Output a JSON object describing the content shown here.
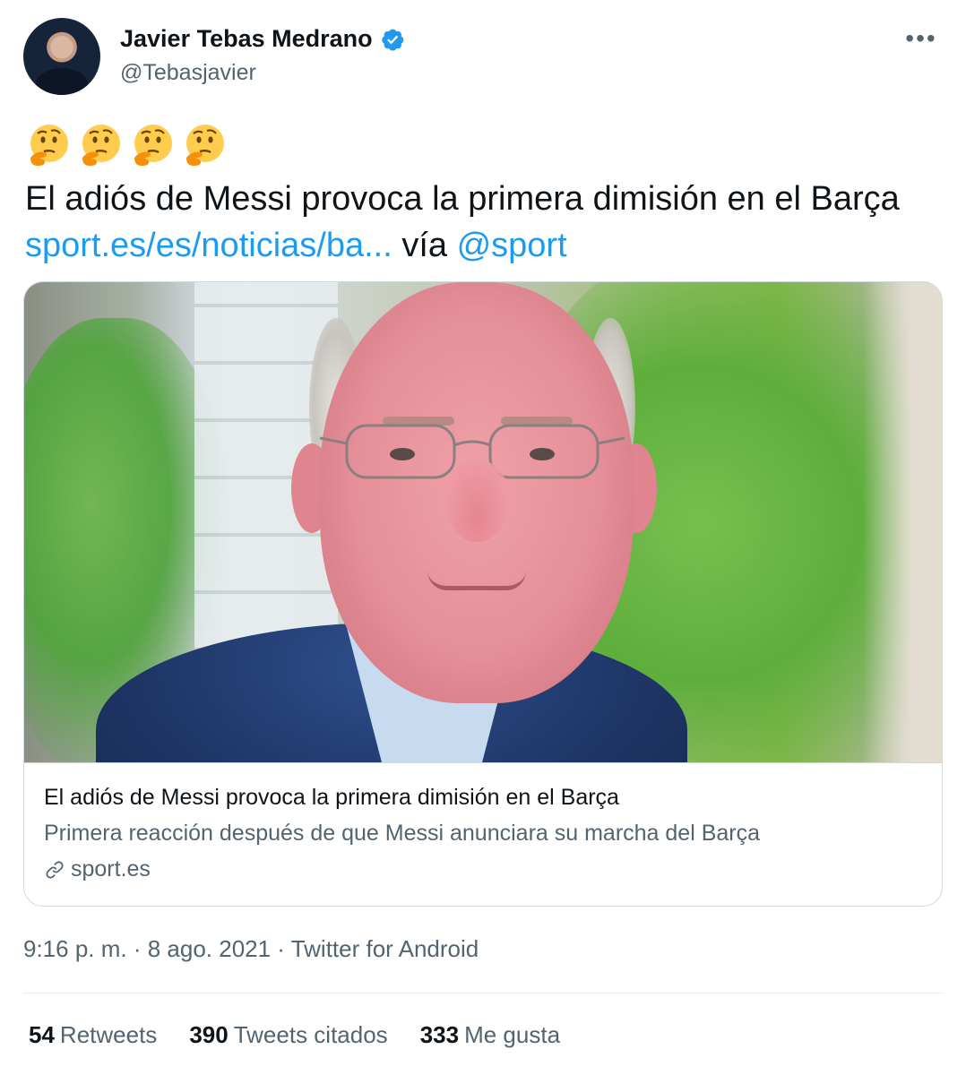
{
  "author": {
    "display_name": "Javier Tebas Medrano",
    "handle": "@Tebasjavier",
    "verified": true
  },
  "more_label": "•••",
  "emojis": [
    "thinking-face",
    "thinking-face",
    "thinking-face",
    "thinking-face"
  ],
  "tweet": {
    "text_main": "El adiós de Messi provoca la primera dimisión en el Barça ",
    "link_url": "sport.es/es/noticias/ba...",
    "via_text": " vía ",
    "mention": "@sport"
  },
  "card": {
    "title": "El adiós de Messi provoca la primera dimisión en el Barça",
    "description": "Primera reacción después de que Messi anunciara su marcha del Barça",
    "domain": "sport.es"
  },
  "meta": "9:16 p. m. · 8 ago. 2021 · Twitter for Android",
  "stats": {
    "retweets_count": "54",
    "retweets_label": "Retweets",
    "quotes_count": "390",
    "quotes_label": "Tweets citados",
    "likes_count": "333",
    "likes_label": "Me gusta"
  },
  "colors": {
    "link": "#1d9bf0",
    "verified": "#1d9bf0",
    "secondary_text": "#536471"
  }
}
